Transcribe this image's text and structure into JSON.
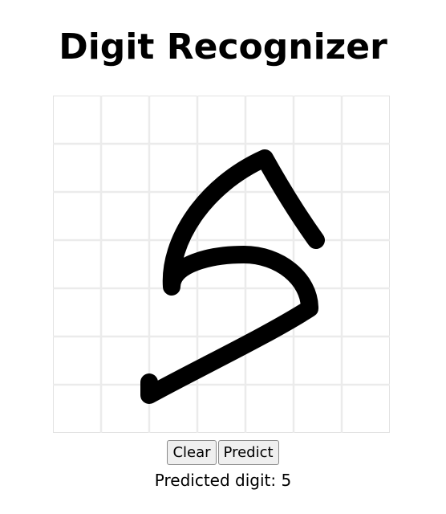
{
  "page": {
    "title": "Digit Recognizer"
  },
  "canvas": {
    "grid_color": "#ebebeb",
    "stroke_color": "#000000"
  },
  "controls": {
    "clear_label": "Clear",
    "predict_label": "Predict"
  },
  "result": {
    "label": "Predicted digit:",
    "value": "5"
  }
}
